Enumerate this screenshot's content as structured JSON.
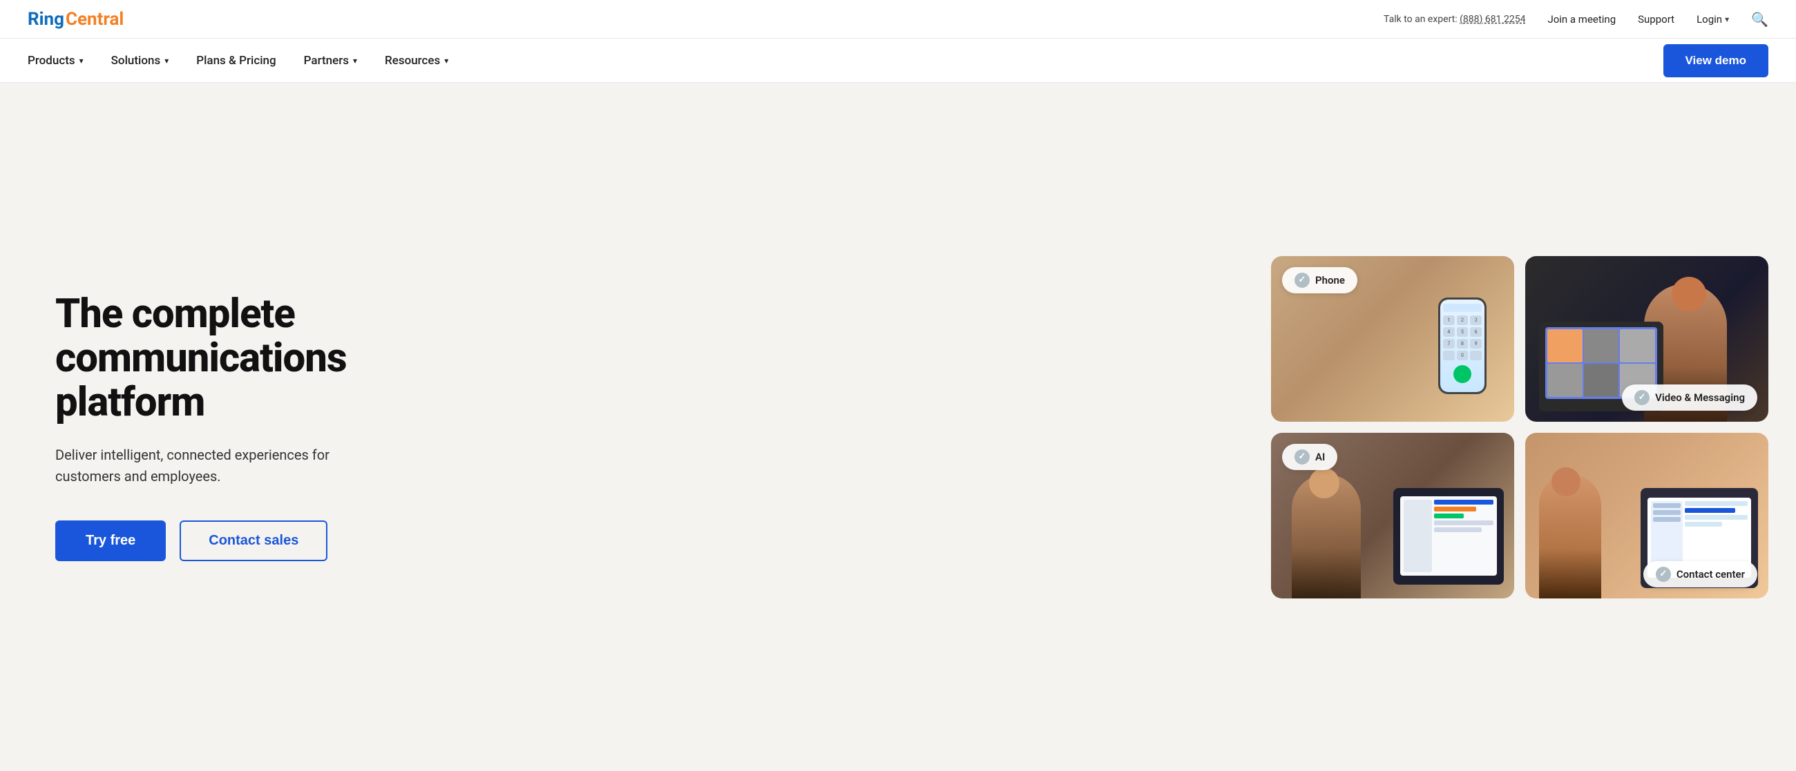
{
  "topbar": {
    "expert_prefix": "Talk to an expert:",
    "phone": "(888) 681 2254",
    "join_meeting": "Join a meeting",
    "support": "Support",
    "login": "Login"
  },
  "logo": {
    "ring": "Ring",
    "central": "Central"
  },
  "nav": {
    "products": "Products",
    "solutions": "Solutions",
    "plans_pricing": "Plans & Pricing",
    "partners": "Partners",
    "resources": "Resources",
    "view_demo": "View demo"
  },
  "hero": {
    "heading_line1": "The complete",
    "heading_line2": "communications platform",
    "subtext": "Deliver intelligent, connected experiences for customers and employees.",
    "try_free": "Try free",
    "contact_sales": "Contact sales"
  },
  "cards": {
    "phone_label": "Phone",
    "video_label": "Video & Messaging",
    "ai_label": "AI",
    "contact_label": "Contact center"
  },
  "colors": {
    "primary_blue": "#1a56db",
    "orange": "#f48024",
    "logo_blue": "#0f6cbd"
  }
}
